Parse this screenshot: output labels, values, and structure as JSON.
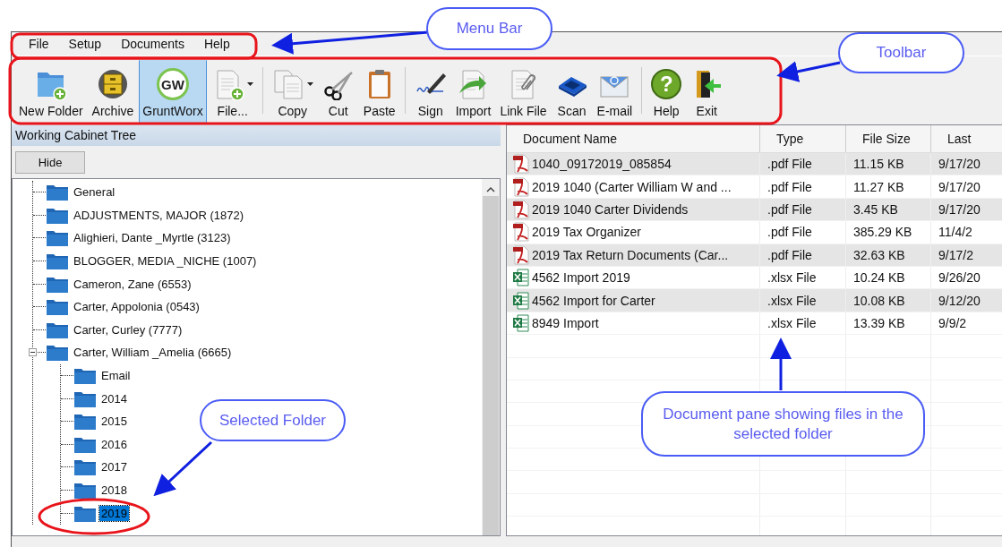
{
  "menu_bar": {
    "items": [
      "File",
      "Setup",
      "Documents",
      "Help"
    ]
  },
  "toolbar": {
    "groups": [
      {
        "items": [
          {
            "label": "New Folder",
            "selected": false,
            "dropdown": false
          },
          {
            "label": "Archive",
            "selected": false,
            "dropdown": false
          },
          {
            "label": "GruntWorx",
            "selected": true,
            "dropdown": false,
            "logo_text": "GW"
          },
          {
            "label": "File...",
            "selected": false,
            "dropdown": true
          }
        ]
      },
      {
        "items": [
          {
            "label": "Copy",
            "selected": false,
            "dropdown": true
          },
          {
            "label": "Cut",
            "selected": false,
            "dropdown": false
          },
          {
            "label": "Paste",
            "selected": false,
            "dropdown": false
          }
        ]
      },
      {
        "items": [
          {
            "label": "Sign",
            "selected": false,
            "dropdown": false
          },
          {
            "label": "Import",
            "selected": false,
            "dropdown": false
          },
          {
            "label": "Link File",
            "selected": false,
            "dropdown": false
          },
          {
            "label": "Scan",
            "selected": false,
            "dropdown": false
          },
          {
            "label": "E-mail",
            "selected": false,
            "dropdown": false
          }
        ]
      },
      {
        "items": [
          {
            "label": "Help",
            "selected": false,
            "dropdown": false,
            "glyph": "?"
          },
          {
            "label": "Exit",
            "selected": false,
            "dropdown": false
          }
        ]
      }
    ]
  },
  "tree_pane": {
    "title": "Working Cabinet Tree",
    "hide_button": "Hide",
    "items": [
      {
        "label": "General",
        "selected": false
      },
      {
        "label": "ADJUSTMENTS, MAJOR (1872)",
        "selected": false
      },
      {
        "label": "Alighieri, Dante _Myrtle (3123)",
        "selected": false
      },
      {
        "label": "BLOGGER, MEDIA _NICHE (1007)",
        "selected": false
      },
      {
        "label": "Cameron, Zane (6553)",
        "selected": false
      },
      {
        "label": "Carter, Appolonia (0543)",
        "selected": false
      },
      {
        "label": "Carter, Curley (7777)",
        "selected": false
      },
      {
        "label": "Carter, William _Amelia (6665)",
        "selected": false,
        "expanded": true,
        "children": [
          {
            "label": "Email",
            "selected": false
          },
          {
            "label": "2014",
            "selected": false
          },
          {
            "label": "2015",
            "selected": false
          },
          {
            "label": "2016",
            "selected": false
          },
          {
            "label": "2017",
            "selected": false
          },
          {
            "label": "2018",
            "selected": false
          },
          {
            "label": "2019",
            "selected": true
          }
        ]
      }
    ]
  },
  "document_pane": {
    "columns": [
      "Document Name",
      "Type",
      "File Size",
      "Last"
    ],
    "rows": [
      {
        "kind": "pdf",
        "cells": [
          "1040_09172019_085854",
          ".pdf File",
          "11.15 KB",
          "9/17/20"
        ]
      },
      {
        "kind": "pdf",
        "cells": [
          "2019 1040 (Carter William W and ...",
          ".pdf File",
          "11.27 KB",
          "9/17/20"
        ]
      },
      {
        "kind": "pdf",
        "cells": [
          "2019 1040 Carter Dividends",
          ".pdf File",
          "3.45 KB",
          "9/17/20"
        ]
      },
      {
        "kind": "pdf",
        "cells": [
          "2019 Tax Organizer",
          ".pdf File",
          "385.29 KB",
          "11/4/2"
        ]
      },
      {
        "kind": "pdf",
        "cells": [
          "2019 Tax Return Documents (Car...",
          ".pdf File",
          "32.63 KB",
          "9/17/2"
        ]
      },
      {
        "kind": "xlsx",
        "cells": [
          "4562 Import 2019",
          ".xlsx File",
          "10.24 KB",
          "9/26/20"
        ]
      },
      {
        "kind": "xlsx",
        "cells": [
          "4562 Import for Carter",
          ".xlsx File",
          "10.08 KB",
          "9/12/20"
        ]
      },
      {
        "kind": "xlsx",
        "cells": [
          "8949 Import",
          ".xlsx File",
          "13.39 KB",
          "9/9/2"
        ]
      }
    ]
  },
  "annotations": [
    "Menu Bar",
    "Toolbar",
    "Selected Folder",
    "Document pane showing files in the selected folder"
  ]
}
